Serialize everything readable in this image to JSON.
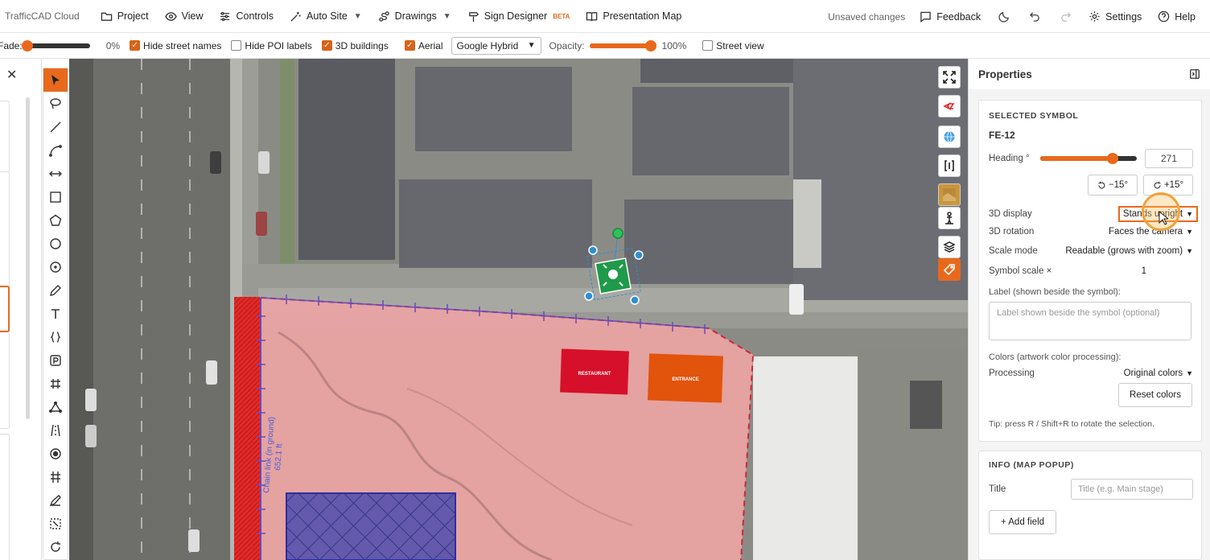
{
  "app": {
    "brand": "TrafficCAD Cloud"
  },
  "menu": [
    {
      "label": "Project",
      "icon": "folder-icon",
      "chevron": false
    },
    {
      "label": "View",
      "icon": "eye-icon",
      "chevron": false
    },
    {
      "label": "Controls",
      "icon": "sliders-icon",
      "chevron": false
    },
    {
      "label": "Auto Site",
      "icon": "magic-wand-icon",
      "chevron": true
    },
    {
      "label": "Drawings",
      "icon": "route-icon",
      "chevron": true
    },
    {
      "label": "Sign Designer",
      "icon": "signpost-icon",
      "chevron": false,
      "badge": "BETA"
    },
    {
      "label": "Presentation Map",
      "icon": "book-icon",
      "chevron": false
    }
  ],
  "topright": {
    "status": "Unsaved changes",
    "feedback": "Feedback",
    "settings": "Settings",
    "help": "Help"
  },
  "options": {
    "fade_label": "Fade:",
    "fade_value": "0%",
    "fade_fraction": 0.0,
    "hide_street_names": {
      "label": "Hide street names",
      "checked": true
    },
    "hide_poi_labels": {
      "label": "Hide POI labels",
      "checked": false
    },
    "buildings_3d": {
      "label": "3D buildings",
      "checked": true
    },
    "aerial": {
      "label": "Aerial",
      "checked": true
    },
    "basemap": "Google Hybrid",
    "opacity_label": "Opacity:",
    "opacity_value": "100%",
    "opacity_fraction": 1.0,
    "street_view": {
      "label": "Street view",
      "checked": false
    }
  },
  "map": {
    "fence_label": "Chain link (in ground)",
    "fence_length": "652.1 ft",
    "sign_red_text": "RESTAURANT",
    "sign_orange_text": "ENTRANCE"
  },
  "colors": {
    "accent": "#e8691c",
    "zone_fill": "#e8a8a8",
    "zone_dash": "#c92a3c",
    "hatch_blue": "#3840b8",
    "symbol_green": "#1f9a4a"
  },
  "properties": {
    "title": "Properties",
    "selected_title": "SELECTED SYMBOL",
    "symbol_id": "FE-12",
    "heading_label": "Heading °",
    "heading_value": "271",
    "heading_fraction": 0.753,
    "rotate_minus": "−15°",
    "rotate_plus": "+15°",
    "display_label": "3D display",
    "display_value": "Stands upright",
    "rotation_label": "3D rotation",
    "rotation_value": "Faces the camera",
    "scale_mode_label": "Scale mode",
    "scale_mode_value": "Readable (grows with zoom)",
    "symbol_scale_label": "Symbol scale ×",
    "symbol_scale_value": "1",
    "label_field_label": "Label (shown beside the symbol):",
    "label_placeholder": "Label shown beside the symbol (optional)",
    "colors_label": "Colors (artwork color processing):",
    "processing_label": "Processing",
    "processing_value": "Original colors",
    "reset_colors": "Reset colors",
    "tip": "Tip: press R / Shift+R to rotate the selection.",
    "info_title": "INFO (MAP POPUP)",
    "info_title_label": "Title",
    "info_title_placeholder": "Title (e.g. Main stage)",
    "add_field": "+ Add field"
  }
}
